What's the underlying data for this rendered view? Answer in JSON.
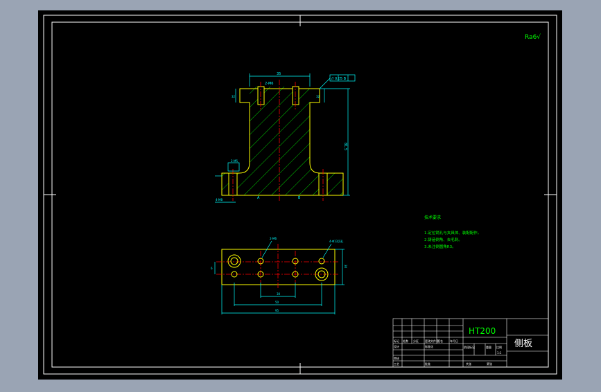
{
  "colors": {
    "app_bg": "#9aa4b4",
    "sheet_bg": "#000000",
    "frame": "#ffffff",
    "part_outline": "#ffff00",
    "hatch": "#00ff00",
    "dimension": "#00ffff",
    "center_line": "#ff0000",
    "notes": "#00ff00"
  },
  "drawing": {
    "roughness_symbol": "Ra6√",
    "front_view": {
      "dims": {
        "top_width": "35",
        "hole_spec": "2-M6",
        "height": "81.5",
        "left_small": "32",
        "right_small": "32",
        "tolerance_frame": "// 0.05 B",
        "bottom_left": "4-M8",
        "base_left": "2-M5",
        "leader_a": "A",
        "leader_b": "B"
      }
    },
    "top_view": {
      "dims": {
        "hole_callout_left": "2-M6",
        "hole_callout_right": "4-Φ13沉孔",
        "inner_spacing": "30",
        "mid_spacing": "50",
        "overall_width": "95",
        "height_right": "30",
        "height_left": "6"
      }
    },
    "notes": {
      "heading": "技术要求",
      "items": [
        "1.定位销孔与夹具体、装配配作。",
        "2.铸造倒角、去毛刺。",
        "3.未注倒圆角R3。"
      ]
    },
    "title_block": {
      "material": "HT200",
      "part_name": "侧板",
      "cells": [
        "标记",
        "处数",
        "分区",
        "更改文件号",
        "签名",
        "年月日",
        "设计",
        "标准化",
        "审核",
        "工艺",
        "批准",
        "阶段标记",
        "重量",
        "比例",
        "1:1",
        "共张",
        "第张"
      ]
    }
  }
}
